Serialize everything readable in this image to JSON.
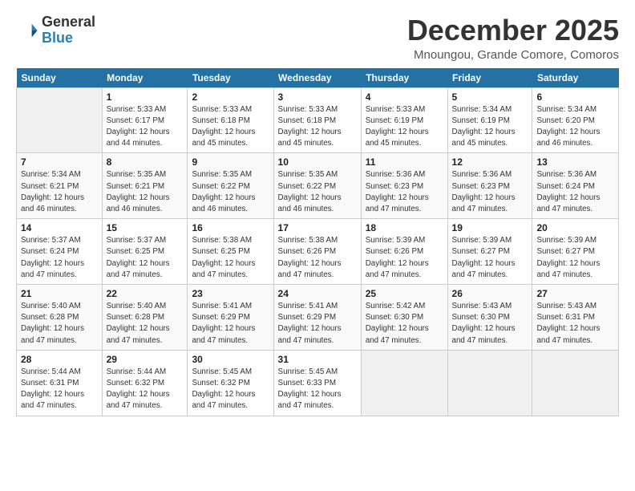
{
  "logo": {
    "general": "General",
    "blue": "Blue"
  },
  "title": "December 2025",
  "subtitle": "Mnoungou, Grande Comore, Comoros",
  "days_header": [
    "Sunday",
    "Monday",
    "Tuesday",
    "Wednesday",
    "Thursday",
    "Friday",
    "Saturday"
  ],
  "weeks": [
    [
      {
        "day": "",
        "info": ""
      },
      {
        "day": "1",
        "info": "Sunrise: 5:33 AM\nSunset: 6:17 PM\nDaylight: 12 hours\nand 44 minutes."
      },
      {
        "day": "2",
        "info": "Sunrise: 5:33 AM\nSunset: 6:18 PM\nDaylight: 12 hours\nand 45 minutes."
      },
      {
        "day": "3",
        "info": "Sunrise: 5:33 AM\nSunset: 6:18 PM\nDaylight: 12 hours\nand 45 minutes."
      },
      {
        "day": "4",
        "info": "Sunrise: 5:33 AM\nSunset: 6:19 PM\nDaylight: 12 hours\nand 45 minutes."
      },
      {
        "day": "5",
        "info": "Sunrise: 5:34 AM\nSunset: 6:19 PM\nDaylight: 12 hours\nand 45 minutes."
      },
      {
        "day": "6",
        "info": "Sunrise: 5:34 AM\nSunset: 6:20 PM\nDaylight: 12 hours\nand 46 minutes."
      }
    ],
    [
      {
        "day": "7",
        "info": "Sunrise: 5:34 AM\nSunset: 6:21 PM\nDaylight: 12 hours\nand 46 minutes."
      },
      {
        "day": "8",
        "info": "Sunrise: 5:35 AM\nSunset: 6:21 PM\nDaylight: 12 hours\nand 46 minutes."
      },
      {
        "day": "9",
        "info": "Sunrise: 5:35 AM\nSunset: 6:22 PM\nDaylight: 12 hours\nand 46 minutes."
      },
      {
        "day": "10",
        "info": "Sunrise: 5:35 AM\nSunset: 6:22 PM\nDaylight: 12 hours\nand 46 minutes."
      },
      {
        "day": "11",
        "info": "Sunrise: 5:36 AM\nSunset: 6:23 PM\nDaylight: 12 hours\nand 47 minutes."
      },
      {
        "day": "12",
        "info": "Sunrise: 5:36 AM\nSunset: 6:23 PM\nDaylight: 12 hours\nand 47 minutes."
      },
      {
        "day": "13",
        "info": "Sunrise: 5:36 AM\nSunset: 6:24 PM\nDaylight: 12 hours\nand 47 minutes."
      }
    ],
    [
      {
        "day": "14",
        "info": "Sunrise: 5:37 AM\nSunset: 6:24 PM\nDaylight: 12 hours\nand 47 minutes."
      },
      {
        "day": "15",
        "info": "Sunrise: 5:37 AM\nSunset: 6:25 PM\nDaylight: 12 hours\nand 47 minutes."
      },
      {
        "day": "16",
        "info": "Sunrise: 5:38 AM\nSunset: 6:25 PM\nDaylight: 12 hours\nand 47 minutes."
      },
      {
        "day": "17",
        "info": "Sunrise: 5:38 AM\nSunset: 6:26 PM\nDaylight: 12 hours\nand 47 minutes."
      },
      {
        "day": "18",
        "info": "Sunrise: 5:39 AM\nSunset: 6:26 PM\nDaylight: 12 hours\nand 47 minutes."
      },
      {
        "day": "19",
        "info": "Sunrise: 5:39 AM\nSunset: 6:27 PM\nDaylight: 12 hours\nand 47 minutes."
      },
      {
        "day": "20",
        "info": "Sunrise: 5:39 AM\nSunset: 6:27 PM\nDaylight: 12 hours\nand 47 minutes."
      }
    ],
    [
      {
        "day": "21",
        "info": "Sunrise: 5:40 AM\nSunset: 6:28 PM\nDaylight: 12 hours\nand 47 minutes."
      },
      {
        "day": "22",
        "info": "Sunrise: 5:40 AM\nSunset: 6:28 PM\nDaylight: 12 hours\nand 47 minutes."
      },
      {
        "day": "23",
        "info": "Sunrise: 5:41 AM\nSunset: 6:29 PM\nDaylight: 12 hours\nand 47 minutes."
      },
      {
        "day": "24",
        "info": "Sunrise: 5:41 AM\nSunset: 6:29 PM\nDaylight: 12 hours\nand 47 minutes."
      },
      {
        "day": "25",
        "info": "Sunrise: 5:42 AM\nSunset: 6:30 PM\nDaylight: 12 hours\nand 47 minutes."
      },
      {
        "day": "26",
        "info": "Sunrise: 5:43 AM\nSunset: 6:30 PM\nDaylight: 12 hours\nand 47 minutes."
      },
      {
        "day": "27",
        "info": "Sunrise: 5:43 AM\nSunset: 6:31 PM\nDaylight: 12 hours\nand 47 minutes."
      }
    ],
    [
      {
        "day": "28",
        "info": "Sunrise: 5:44 AM\nSunset: 6:31 PM\nDaylight: 12 hours\nand 47 minutes."
      },
      {
        "day": "29",
        "info": "Sunrise: 5:44 AM\nSunset: 6:32 PM\nDaylight: 12 hours\nand 47 minutes."
      },
      {
        "day": "30",
        "info": "Sunrise: 5:45 AM\nSunset: 6:32 PM\nDaylight: 12 hours\nand 47 minutes."
      },
      {
        "day": "31",
        "info": "Sunrise: 5:45 AM\nSunset: 6:33 PM\nDaylight: 12 hours\nand 47 minutes."
      },
      {
        "day": "",
        "info": ""
      },
      {
        "day": "",
        "info": ""
      },
      {
        "day": "",
        "info": ""
      }
    ]
  ]
}
